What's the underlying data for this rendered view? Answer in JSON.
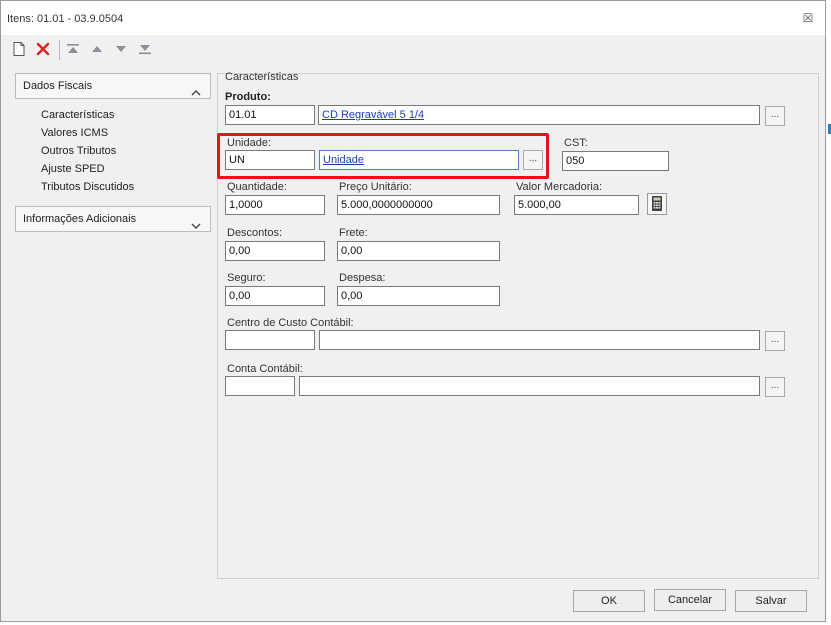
{
  "window": {
    "title": "Itens: 01.01 - 03.9.0504",
    "close_glyph": "☒"
  },
  "toolbar": {
    "icons": [
      "new-document-icon",
      "delete-x-icon",
      "move-first-icon",
      "move-up-icon",
      "move-down-icon",
      "move-last-icon"
    ]
  },
  "sidebar": {
    "sections": [
      {
        "label": "Dados Fiscais",
        "expanded": true,
        "items": [
          "Características",
          "Valores ICMS",
          "Outros Tributos",
          "Ajuste SPED",
          "Tributos Discutidos"
        ]
      },
      {
        "label": "Informações Adicionais",
        "expanded": false,
        "items": []
      }
    ]
  },
  "form": {
    "section_title": "Características",
    "produto": {
      "label": "Produto:",
      "code": "01.01",
      "description": "CD Regravável 5 1/4"
    },
    "unidade": {
      "label": "Unidade:",
      "code": "UN",
      "description": "Unidade"
    },
    "cst": {
      "label": "CST:",
      "value": "050"
    },
    "quantidade": {
      "label": "Quantidade:",
      "value": "1,0000"
    },
    "preco": {
      "label": "Preço Unitário:",
      "value": "5.000,0000000000"
    },
    "valor_mercadoria": {
      "label": "Valor Mercadoria:",
      "value": "5.000,00"
    },
    "descontos": {
      "label": "Descontos:",
      "value": "0,00"
    },
    "frete": {
      "label": "Frete:",
      "value": "0,00"
    },
    "seguro": {
      "label": "Seguro:",
      "value": "0,00"
    },
    "despesa": {
      "label": "Despesa:",
      "value": "0,00"
    },
    "centro_custo": {
      "label": "Centro de Custo Contábil:",
      "code": "",
      "description": ""
    },
    "conta_contabil": {
      "label": "Conta Contábil:",
      "code": "",
      "description": ""
    },
    "ellipsis": "..."
  },
  "buttons": {
    "ok": "OK",
    "cancel": "Cancelar",
    "save": "Salvar"
  },
  "colors": {
    "highlight": "#e8121b",
    "link": "#1a3fb5",
    "delete_icon": "#e02020",
    "toolbar_icon": "#8a8f9a"
  }
}
